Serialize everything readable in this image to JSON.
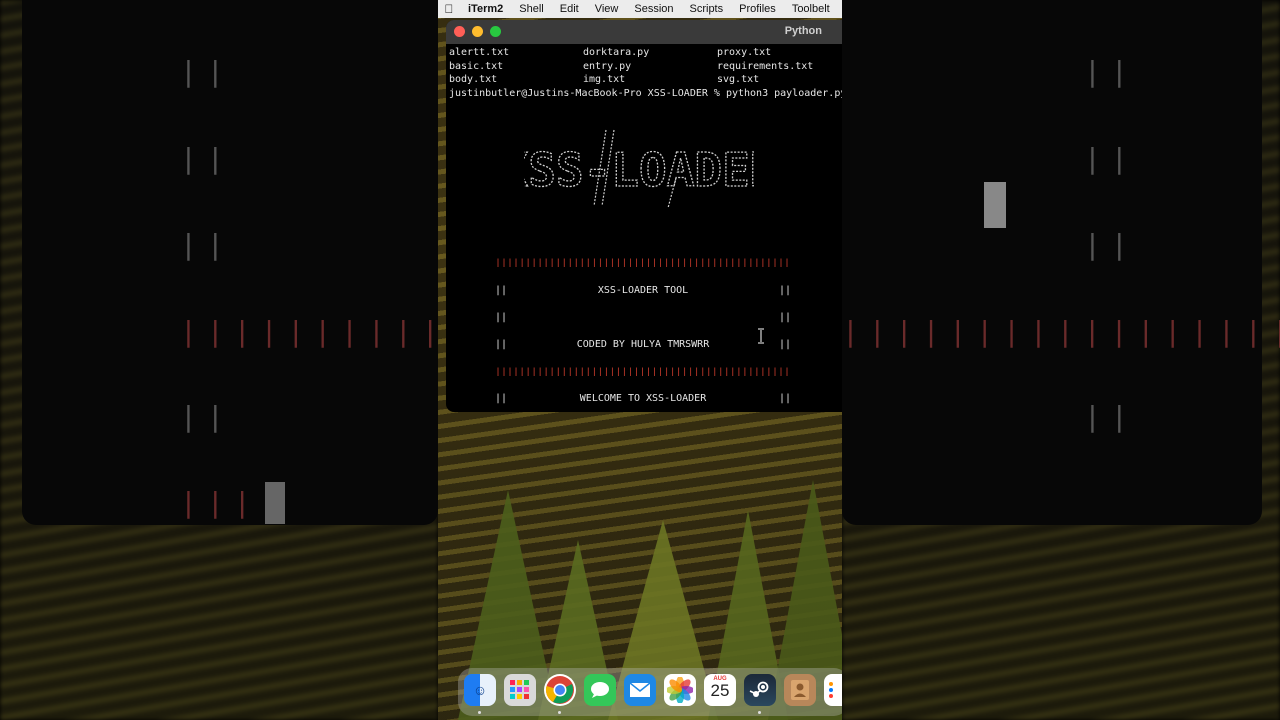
{
  "menubar": {
    "app": "iTerm2",
    "items": [
      "Shell",
      "Edit",
      "View",
      "Session",
      "Scripts",
      "Profiles",
      "Toolbelt"
    ]
  },
  "window": {
    "title": "Python"
  },
  "terminal": {
    "files": [
      "alertt.txt",
      "dorktara.py",
      "proxy.txt",
      "basic.txt",
      "entry.py",
      "requirements.txt",
      "body.txt",
      "img.txt",
      "svg.txt"
    ],
    "prompt": "justinbutler@Justins-MacBook-Pro XSS-LOADER % python3 payloader.py",
    "logo_text": "XSS-LOADER",
    "banner_bar": "||||||||||||||||||||||||||||||||||||||||||||||||||||||||||||||",
    "pipe": "||",
    "tool_line": "XSS-LOADER TOOL",
    "coded_line": "CODED BY HULYA  TMRSWRR",
    "welcome_line": "WELCOME TO XSS-LOADER",
    "partial_bar": "||||"
  },
  "dock": {
    "icons": [
      "finder-icon",
      "launchpad-icon",
      "chrome-icon",
      "messages-icon",
      "mail-icon",
      "photos-icon",
      "calendar-icon",
      "steam-icon",
      "contacts-icon",
      "reminders-icon"
    ],
    "calendar_month": "AUG",
    "calendar_day": "25"
  },
  "colors": {
    "bar_red": "#c0392b",
    "terminal_bg": "#000000",
    "menubar_bg": "#ececec"
  }
}
